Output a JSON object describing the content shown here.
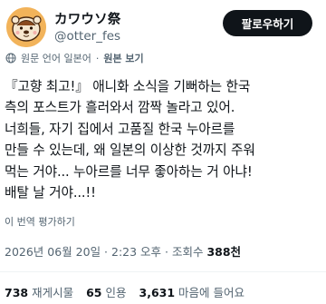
{
  "author": {
    "display_name": "カワウソ祭",
    "handle": "@otter_fes",
    "avatar_icon": "otter-avatar-icon"
  },
  "follow_button": {
    "label": "팔로우하기"
  },
  "translation": {
    "original_language": "원문 언어 일본어",
    "show_original": "원본 보기",
    "rate_translation": "이 번역 평가하기"
  },
  "post": {
    "lines": [
      "『고향 최고!』 애니화 소식을 기뻐하는 한국",
      "측의 포스트가 흘러와서 깜짝 놀라고 있어.",
      "너희들, 자기 집에서 고품질 한국 누아르를",
      "만들 수 있는데, 왜 일본의 이상한 것까지 주워",
      "먹는 거야... 누아르를 너무 좋아하는 거 아냐!",
      "배탈 날 거야...!!"
    ]
  },
  "meta": {
    "timestamp": "2026년 06월 20일 · 2:23 오후",
    "views_label": "· 조회수",
    "views_count": "388천"
  },
  "stats": {
    "reposts_count": "738",
    "reposts_label": "재게시물",
    "quotes_count": "65",
    "quotes_label": "인용",
    "likes_count": "3,631",
    "likes_label": "마음에 들어요"
  },
  "colors": {
    "text_primary": "#0f1419",
    "text_secondary": "#536471",
    "button_bg": "#0f1419",
    "avatar_bg": "#f2b35a"
  }
}
